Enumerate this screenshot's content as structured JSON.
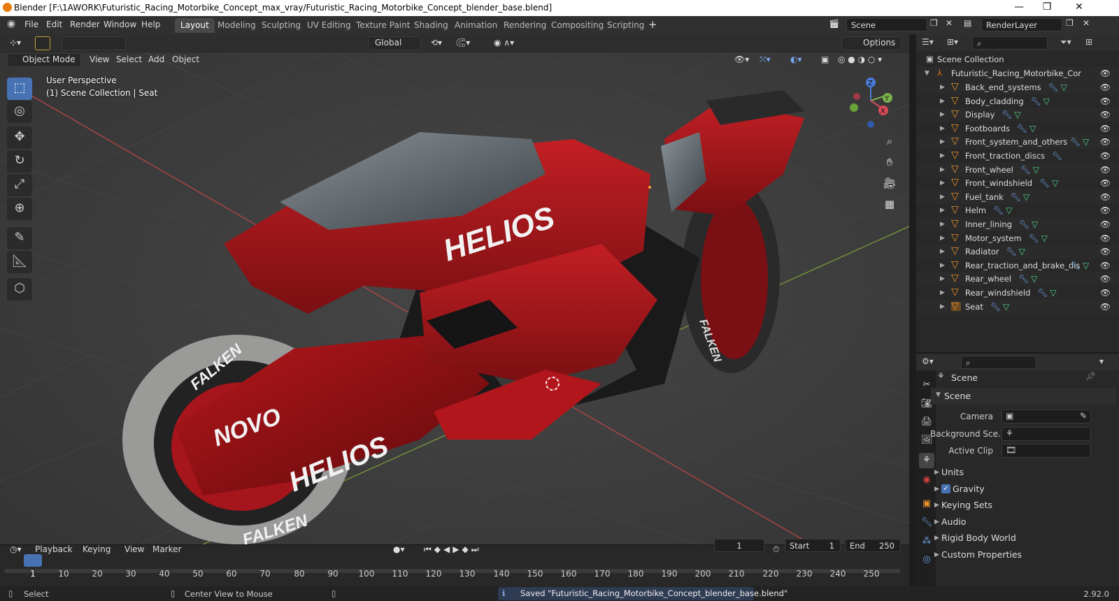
{
  "window": {
    "title": "Blender [F:\\1AWORK\\Futuristic_Racing_Motorbike_Concept_max_vray/Futuristic_Racing_Motorbike_Concept_blender_base.blend]",
    "controls": [
      "—",
      "❐",
      "✕"
    ]
  },
  "menu": [
    "File",
    "Edit",
    "Render",
    "Window",
    "Help"
  ],
  "workspaces": [
    "Layout",
    "Modeling",
    "Sculpting",
    "UV Editing",
    "Texture Paint",
    "Shading",
    "Animation",
    "Rendering",
    "Compositing",
    "Scripting"
  ],
  "active_workspace": "Layout",
  "scene_field": "Scene",
  "renderlayer_field": "RenderLayer",
  "viewport": {
    "mode": "Object Mode",
    "menus": [
      "View",
      "Select",
      "Add",
      "Object"
    ],
    "orientation": "Global",
    "options": "Options",
    "overlay_line1": "User Perspective",
    "overlay_line2": "(1) Scene Collection | Seat",
    "axis_labels": [
      "Z",
      "Y",
      "X"
    ],
    "decals": [
      "HELIOS",
      "HELIOS",
      "FALKEN",
      "FALKEN",
      "NOVO",
      "FALKEN"
    ]
  },
  "timeline": {
    "menus": [
      "Playback",
      "Keying",
      "View",
      "Marker"
    ],
    "current_frame": "1",
    "start_label": "Start",
    "start_value": "1",
    "end_label": "End",
    "end_value": "250",
    "ruler": [
      "1",
      "10",
      "20",
      "30",
      "40",
      "50",
      "60",
      "70",
      "80",
      "90",
      "100",
      "110",
      "120",
      "130",
      "140",
      "150",
      "160",
      "170",
      "180",
      "190",
      "200",
      "210",
      "220",
      "230",
      "240",
      "250"
    ]
  },
  "status": {
    "select": "Select",
    "center_view": "Center View to Mouse",
    "message": "Saved \"Futuristic_Racing_Motorbike_Concept_blender_base.blend\"",
    "version": "2.92.0"
  },
  "outliner": {
    "root": "Scene Collection",
    "collection": "Futuristic_Racing_Motorbike_Cor",
    "items": [
      {
        "name": "Back_end_systems"
      },
      {
        "name": "Body_cladding"
      },
      {
        "name": "Display"
      },
      {
        "name": "Footboards"
      },
      {
        "name": "Front_system_and_others"
      },
      {
        "name": "Front_traction_discs"
      },
      {
        "name": "Front_wheel"
      },
      {
        "name": "Front_windshield"
      },
      {
        "name": "Fuel_tank"
      },
      {
        "name": "Helm"
      },
      {
        "name": "Inner_lining"
      },
      {
        "name": "Motor_system"
      },
      {
        "name": "Radiator"
      },
      {
        "name": "Rear_traction_and_brake_dis"
      },
      {
        "name": "Rear_wheel"
      },
      {
        "name": "Rear_windshield"
      },
      {
        "name": "Seat"
      }
    ]
  },
  "properties": {
    "context": "Scene",
    "panel": "Scene",
    "camera_label": "Camera",
    "background_label": "Background Sce...",
    "clip_label": "Active Clip",
    "sections": [
      "Units",
      "Gravity",
      "Keying Sets",
      "Audio",
      "Rigid Body World",
      "Custom Properties"
    ],
    "gravity_checked": true
  },
  "colors": {
    "accent": "#4772b3",
    "bike_red": "#a5151b",
    "object_orange": "#e8902a",
    "grid_x": "#b44848",
    "grid_y": "#7a9a3a"
  }
}
